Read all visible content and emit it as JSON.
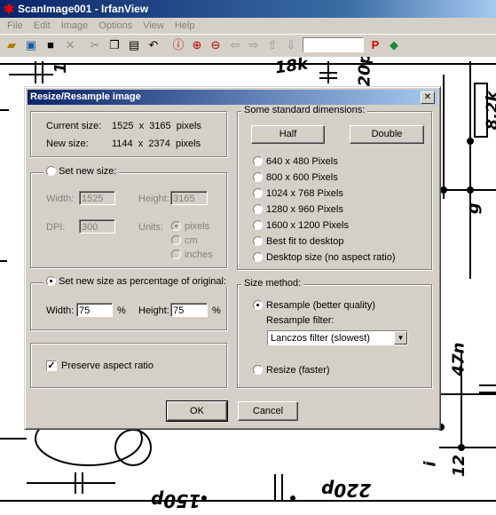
{
  "window": {
    "title": "ScanImage001 - IrfanView"
  },
  "menu": [
    "File",
    "Edit",
    "Image",
    "Options",
    "View",
    "Help"
  ],
  "toolbar": {
    "search_value": ""
  },
  "schematic_labels": {
    "r18k": "18k",
    "c20p": "20p",
    "r82k": "8,2k",
    "c47n": "47n",
    "c150p": "150p",
    "c220p": "220p",
    "num1": "1",
    "num9": "g",
    "num12": "12",
    "num_i": "i"
  },
  "dialog": {
    "title": "Resize/Resample image",
    "current_size_label": "Current size:",
    "current_size_value": "1525  x  3165  pixels",
    "new_size_label": "New size:",
    "new_size_value": "1144  x  2374  pixels",
    "set_new_size_label": "Set new size:",
    "width_label": "Width:",
    "width_value": "1525",
    "height_label": "Height:",
    "height_value": "3165",
    "dpi_label": "DPI:",
    "dpi_value": "300",
    "units_label": "Units:",
    "units": [
      "pixels",
      "cm",
      "inches"
    ],
    "percent_label": "Set new size as percentage of original:",
    "pct_width_label": "Width:",
    "pct_width_value": "75",
    "pct_height_label": "Height:",
    "pct_height_value": "75",
    "pct_sign": "%",
    "preserve_label": "Preserve aspect ratio",
    "preserve_checked": true,
    "standard_dims_label": "Some standard dimensions:",
    "half_button": "Half",
    "double_button": "Double",
    "std_options": [
      "640 x 480 Pixels",
      "800 x 600 Pixels",
      "1024 x 768 Pixels",
      "1280 x 960 Pixels",
      "1600 x 1200 Pixels",
      "Best fit to desktop",
      "Desktop size (no aspect ratio)"
    ],
    "size_method_label": "Size method:",
    "resample_label": "Resample (better quality)",
    "resample_filter_label": "Resample filter:",
    "resample_filter_value": "Lanczos filter (slowest)",
    "resize_label": "Resize (faster)",
    "ok_button": "OK",
    "cancel_button": "Cancel"
  }
}
